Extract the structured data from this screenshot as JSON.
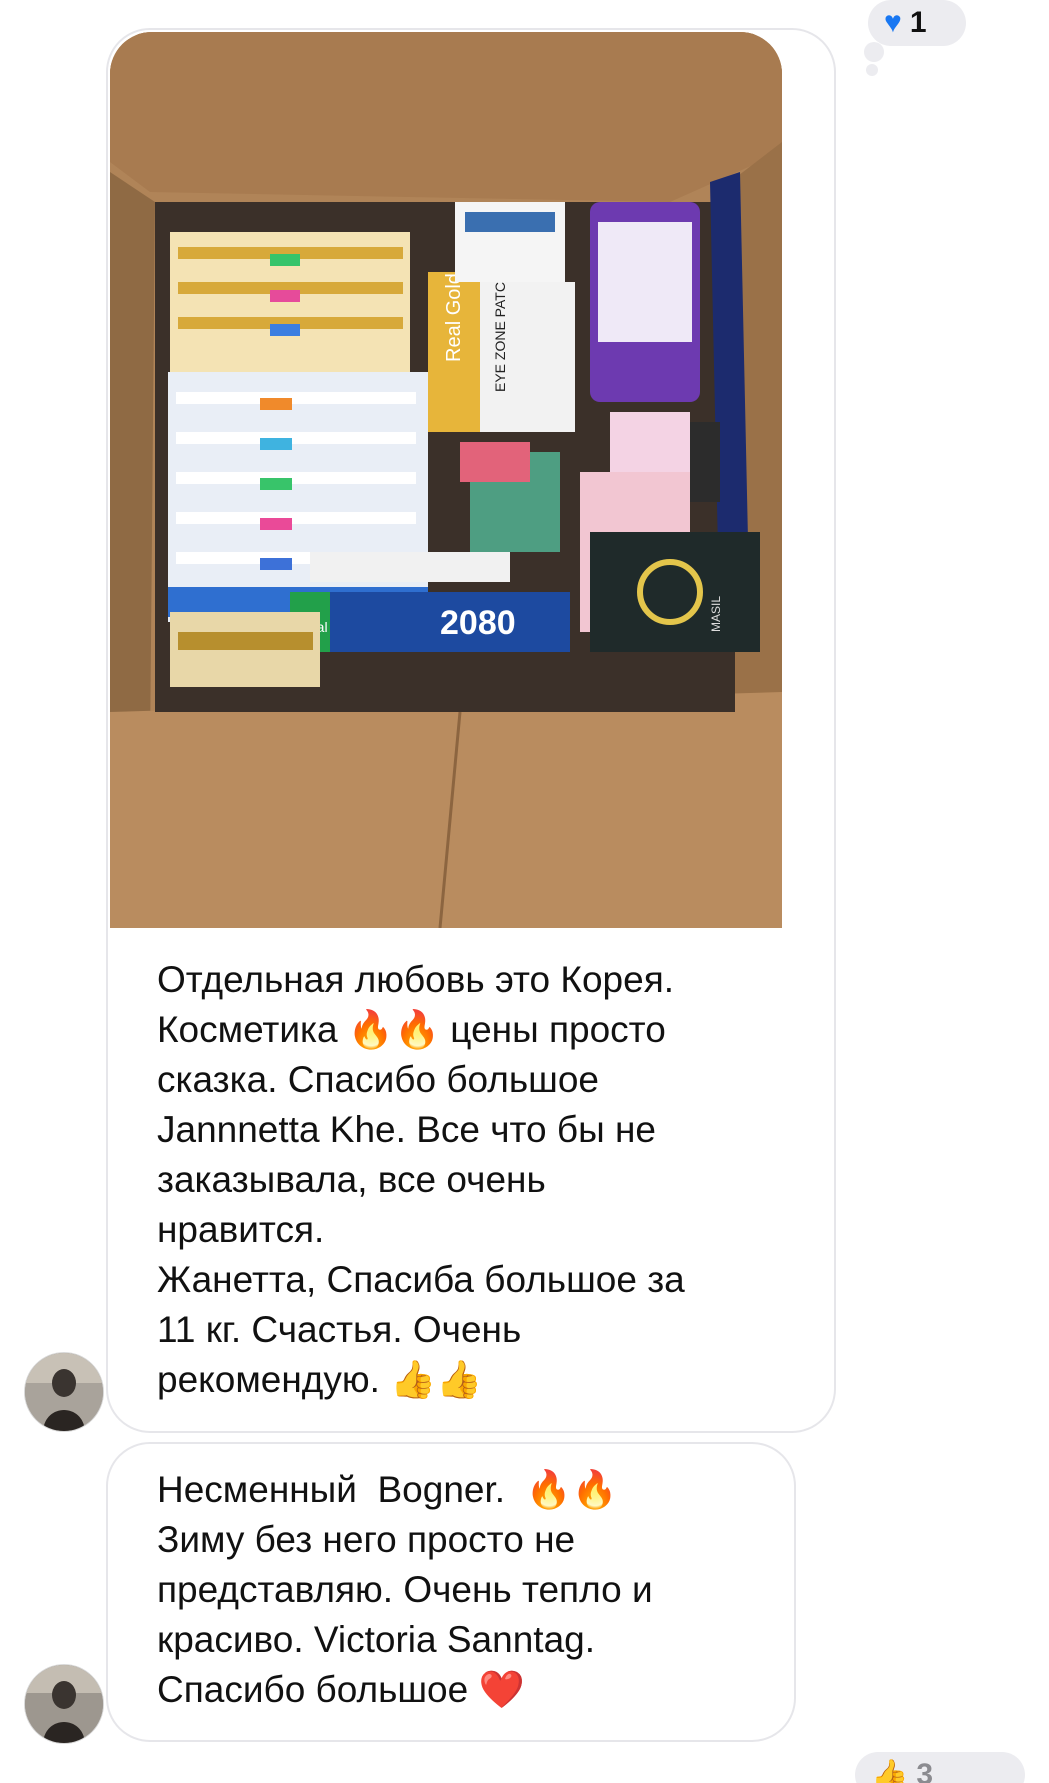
{
  "messages": [
    {
      "text": "Отдельная любовь это Корея.\nКосметика 🔥🔥 цены просто\nсказка. Спасибо большое\nJannnetta Khe. Все что бы не\nзаказывала, все очень\nнравится.\nЖанетта, Спасиба большое за\n11 кг. Счастья. Очень\nрекомендую. 👍👍",
      "reaction": {
        "icon": "blue-heart",
        "count": "1"
      }
    },
    {
      "text": "Несменный  Bogner.  🔥🔥\nЗиму без него просто не\nпредставляю. Очень тепло и\nкрасиво. Victoria Sanntag.\nСпасибо большое ❤️",
      "reaction": {
        "count": "3"
      }
    }
  ],
  "photo": {
    "product_labels": [
      "Real Gold",
      "EYE ZONE PATCH",
      "2080",
      "Total",
      "MASIL"
    ]
  },
  "colors": {
    "bubble_border": "#e6e6ea",
    "reaction_bg": "#ececf0",
    "heart_blue": "#1877f2",
    "text": "#111111"
  }
}
